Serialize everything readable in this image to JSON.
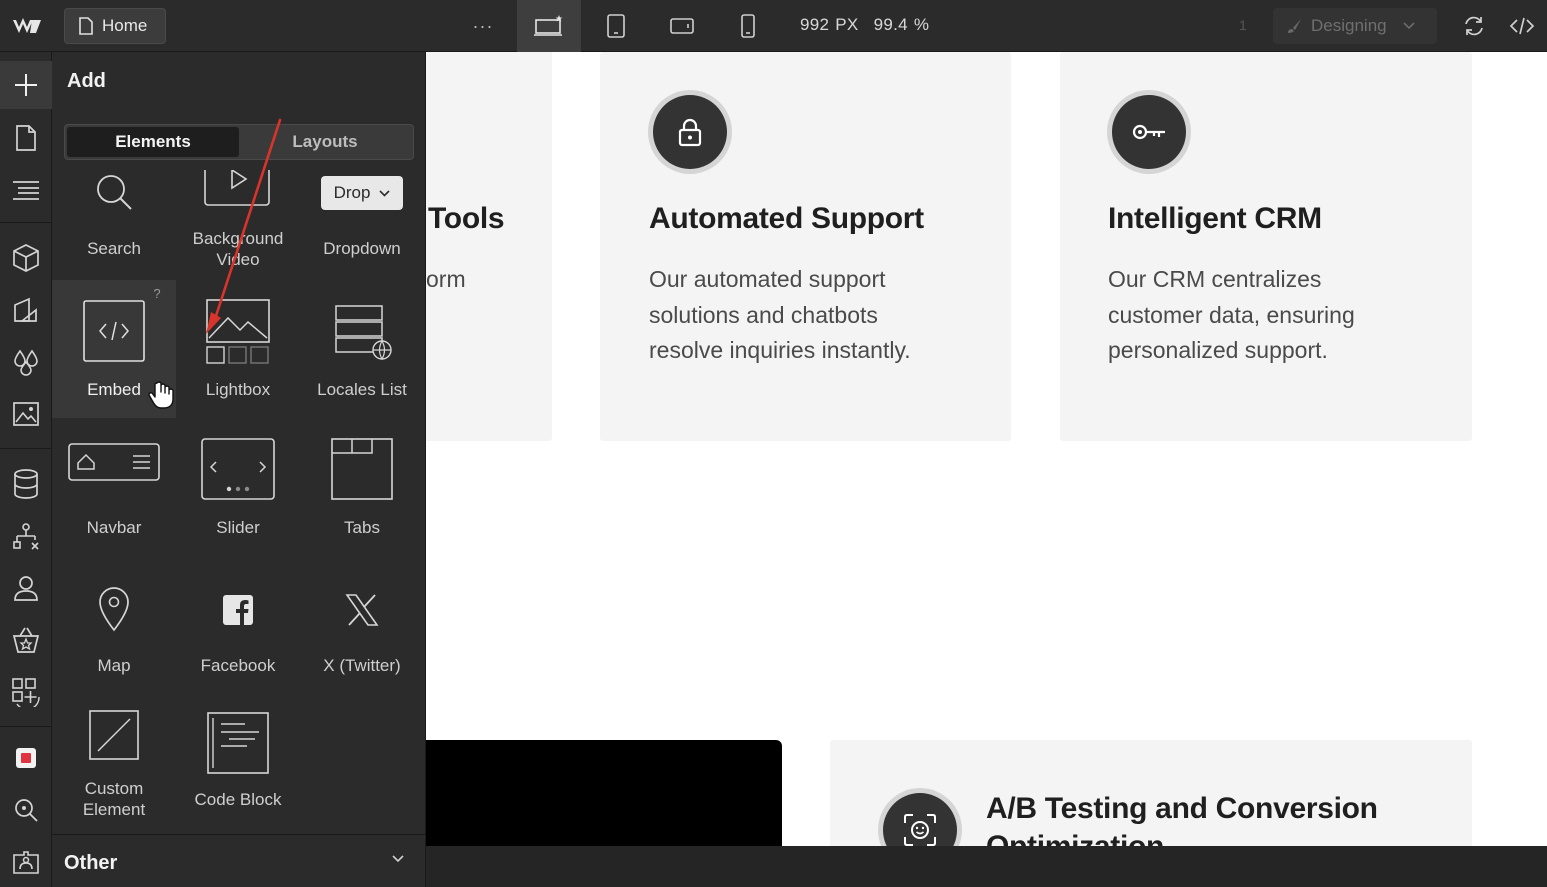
{
  "topbar": {
    "home_label": "Home",
    "more_label": "···",
    "width_value": "992",
    "width_unit": "PX",
    "zoom_value": "99.4",
    "zoom_unit": "%",
    "counter": "1",
    "mode_label": "Designing"
  },
  "panel": {
    "title": "Add",
    "tabs": [
      "Elements",
      "Layouts"
    ],
    "tiles": {
      "search": "Search",
      "background_video_1": "Background",
      "background_video_2": "Video",
      "dropdown": "Dropdown",
      "dropdown_chip": "Drop",
      "embed": "Embed",
      "embed_help": "?",
      "lightbox": "Lightbox",
      "locales_list": "Locales List",
      "navbar": "Navbar",
      "slider": "Slider",
      "tabs": "Tabs",
      "map": "Map",
      "facebook": "Facebook",
      "x_twitter": "X (Twitter)",
      "custom_element_1": "Custom",
      "custom_element_2": "Element",
      "code_block": "Code Block"
    },
    "footer_label": "Other"
  },
  "canvas": {
    "partial_title": "Tools",
    "partial_text": "orm",
    "card1": {
      "title": "Automated Support",
      "text": "Our automated support\nsolutions and chatbots\nresolve inquiries instantly."
    },
    "card2": {
      "title": "Intelligent CRM",
      "text": "Our CRM centralizes\ncustomer data, ensuring\npersonalized support."
    },
    "card3": {
      "title_line1": "A/B Testing and Conversion",
      "title_line2": "Optimization"
    }
  },
  "colors": {
    "chrome_bg": "#2b2b2b",
    "panel_hover": "#383838",
    "card_bg": "#f4f4f4",
    "badge_dark": "#333333",
    "annotation_arrow": "#d9342b"
  }
}
